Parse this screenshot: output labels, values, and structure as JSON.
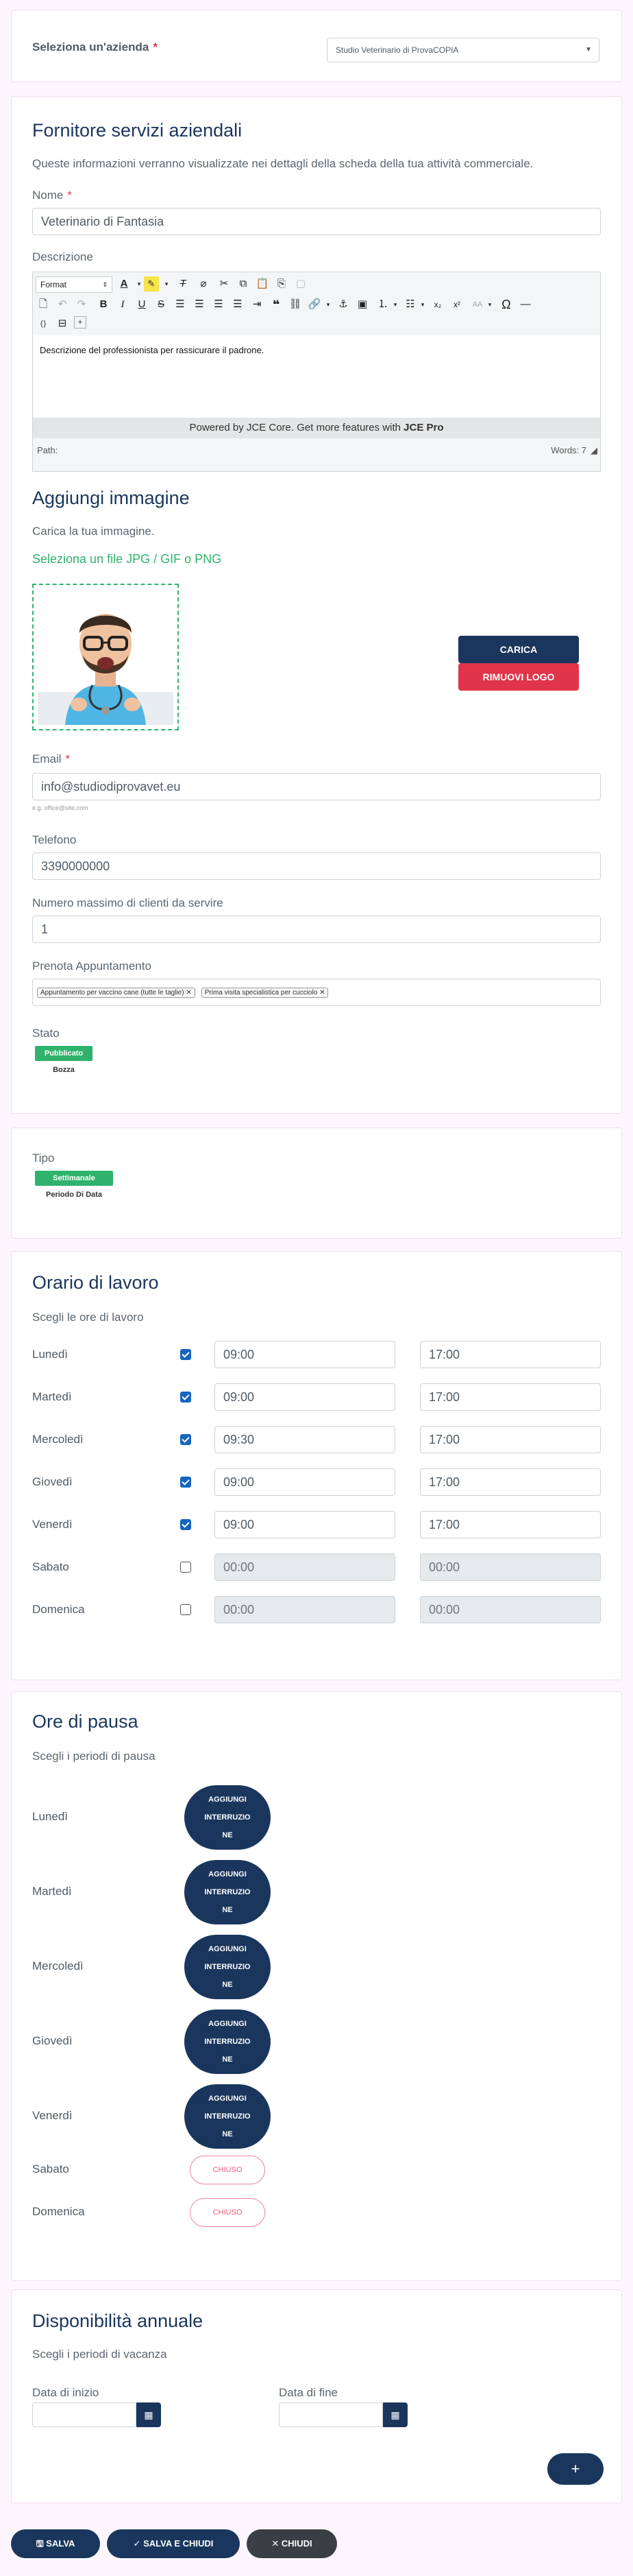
{
  "company": {
    "label": "Seleziona un'azienda",
    "required_mark": "*",
    "selected": "Studio Veterinario di ProvaCOPIA"
  },
  "supplier": {
    "title": "Fornitore servizi aziendali",
    "description": "Queste informazioni verranno visualizzate nei dettagli della scheda della tua attività commerciale.",
    "name_label": "Nome",
    "name_value": "Veterinario di Fantasia",
    "desc_label": "Descrizione",
    "editor": {
      "format_label": "Format",
      "content": "Descrizione del professionista per rassicurare il padrone.",
      "powered_text": "Powered by JCE Core. Get more features with",
      "powered_brand": "JCE Pro",
      "path_label": "Path:",
      "words_label": "Words: 7"
    },
    "image_title": "Aggiungi immagine",
    "image_help": "Carica la tua immagine.",
    "image_select": "Seleziona un file JPG / GIF o PNG",
    "upload_button": "CARICA",
    "remove_logo_button": "RIMUOVI LOGO",
    "email_label": "Email",
    "email_value": "info@studiodiprovavet.eu",
    "email_hint": "e.g. office@site.com",
    "phone_label": "Telefono",
    "phone_value": "3390000000",
    "max_clients_label": "Numero massimo di clienti da servire",
    "max_clients_value": "1",
    "appointments_label": "Prenota Appuntamento",
    "appointment_tags": [
      "Appuntamento per vaccino cane (tutte le taglie)",
      "Prima visita specialistica per cucciolo"
    ],
    "status_label": "Stato",
    "status_on": "Pubblicato",
    "status_off": "Bozza"
  },
  "type": {
    "label": "Tipo",
    "option_on": "Settimanale",
    "option_off": "Periodo Di Data"
  },
  "hours": {
    "title": "Orario di lavoro",
    "subtitle": "Scegli le ore di lavoro",
    "days": [
      {
        "day": "Lunedì",
        "checked": true,
        "start": "09:00",
        "end": "17:00"
      },
      {
        "day": "Martedì",
        "checked": true,
        "start": "09:00",
        "end": "17:00"
      },
      {
        "day": "Mercoledì",
        "checked": true,
        "start": "09:30",
        "end": "17:00"
      },
      {
        "day": "Giovedì",
        "checked": true,
        "start": "09:00",
        "end": "17:00"
      },
      {
        "day": "Venerdì",
        "checked": true,
        "start": "09:00",
        "end": "17:00"
      },
      {
        "day": "Sabato",
        "checked": false,
        "start": "00:00",
        "end": "00:00"
      },
      {
        "day": "Domenica",
        "checked": false,
        "start": "00:00",
        "end": "00:00"
      }
    ]
  },
  "breaks": {
    "title": "Ore di pausa",
    "subtitle": "Scegli i periodi di pausa",
    "add_label_1": "AGGIUNGI",
    "add_label_2": "INTERRUZIO",
    "add_label_3": "NE",
    "closed_label": "CHIUSO",
    "days": [
      "Lunedì",
      "Martedì",
      "Mercoledì",
      "Giovedì",
      "Venerdì",
      "Sabato",
      "Domenica"
    ]
  },
  "availability": {
    "title": "Disponibilità annuale",
    "subtitle": "Scegli i periodi di vacanza",
    "start_label": "Data di inizio",
    "end_label": "Data di fine",
    "add_symbol": "+"
  },
  "footer": {
    "save": "SALVA",
    "save_close": "SALVA E CHIUDI",
    "close": "CHIUDI"
  },
  "colors": {
    "navy": "#1b365d",
    "green": "#2fb36c",
    "red": "#e0344a",
    "footer_dark": "#3a3f45"
  }
}
